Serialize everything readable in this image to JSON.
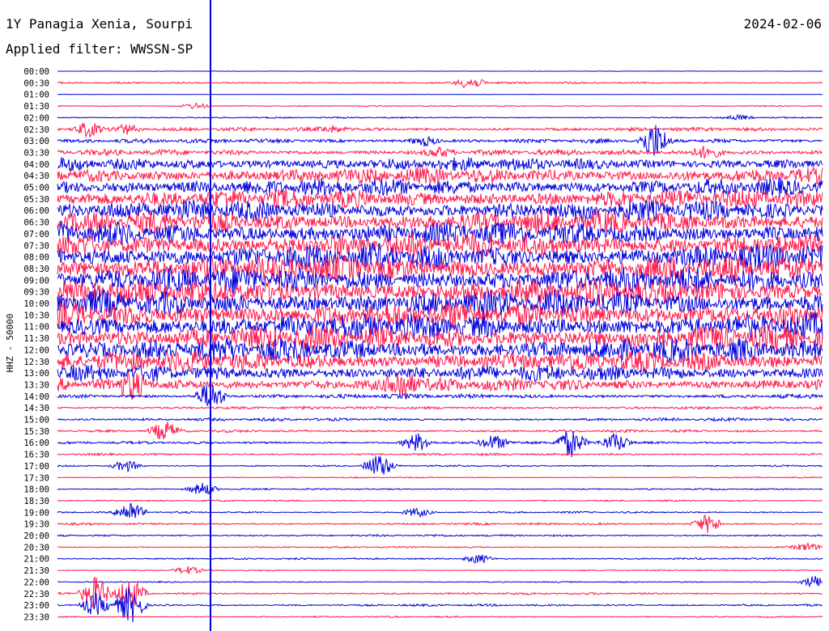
{
  "header": {
    "station": "1Y Panagia Xenia, Sourpi",
    "filter": "Applied filter: WWSSN-SP",
    "date": "2024-02-06"
  },
  "chart_data": {
    "type": "helicorder",
    "title": "1Y Panagia Xenia, Sourpi",
    "date": "2024-02-06",
    "filter": "WWSSN-SP",
    "ylabel": "HHZ - 50000",
    "colors": {
      "even_rows": "#0000dd",
      "odd_rows": "#ff1a4b",
      "time_marker": "#0000dd"
    },
    "rows": [
      {
        "label": "00:00",
        "amplitude": 0.3
      },
      {
        "label": "00:30",
        "amplitude": 1.2
      },
      {
        "label": "01:00",
        "amplitude": 0.3
      },
      {
        "label": "01:30",
        "amplitude": 0.8
      },
      {
        "label": "02:00",
        "amplitude": 1.0
      },
      {
        "label": "02:30",
        "amplitude": 2.5
      },
      {
        "label": "03:00",
        "amplitude": 3.0
      },
      {
        "label": "03:30",
        "amplitude": 4.0
      },
      {
        "label": "04:00",
        "amplitude": 9
      },
      {
        "label": "04:30",
        "amplitude": 11
      },
      {
        "label": "05:00",
        "amplitude": 12
      },
      {
        "label": "05:30",
        "amplitude": 13
      },
      {
        "label": "06:00",
        "amplitude": 14
      },
      {
        "label": "06:30",
        "amplitude": 15
      },
      {
        "label": "07:00",
        "amplitude": 16
      },
      {
        "label": "07:30",
        "amplitude": 17
      },
      {
        "label": "08:00",
        "amplitude": 18
      },
      {
        "label": "08:30",
        "amplitude": 18
      },
      {
        "label": "09:00",
        "amplitude": 18
      },
      {
        "label": "09:30",
        "amplitude": 18
      },
      {
        "label": "10:00",
        "amplitude": 18
      },
      {
        "label": "10:30",
        "amplitude": 18
      },
      {
        "label": "11:00",
        "amplitude": 18
      },
      {
        "label": "11:30",
        "amplitude": 17
      },
      {
        "label": "12:00",
        "amplitude": 16
      },
      {
        "label": "12:30",
        "amplitude": 14
      },
      {
        "label": "13:00",
        "amplitude": 11
      },
      {
        "label": "13:30",
        "amplitude": 9
      },
      {
        "label": "14:00",
        "amplitude": 3
      },
      {
        "label": "14:30",
        "amplitude": 2
      },
      {
        "label": "15:00",
        "amplitude": 2
      },
      {
        "label": "15:30",
        "amplitude": 1.8
      },
      {
        "label": "16:00",
        "amplitude": 1.8
      },
      {
        "label": "16:30",
        "amplitude": 1.5
      },
      {
        "label": "17:00",
        "amplitude": 1.2
      },
      {
        "label": "17:30",
        "amplitude": 0.8
      },
      {
        "label": "18:00",
        "amplitude": 1.0
      },
      {
        "label": "18:30",
        "amplitude": 1.0
      },
      {
        "label": "19:00",
        "amplitude": 1.2
      },
      {
        "label": "19:30",
        "amplitude": 1.4
      },
      {
        "label": "20:00",
        "amplitude": 1.4
      },
      {
        "label": "20:30",
        "amplitude": 1.0
      },
      {
        "label": "21:00",
        "amplitude": 1.2
      },
      {
        "label": "21:30",
        "amplitude": 0.8
      },
      {
        "label": "22:00",
        "amplitude": 0.8
      },
      {
        "label": "22:30",
        "amplitude": 1.5
      },
      {
        "label": "23:00",
        "amplitude": 1.5
      },
      {
        "label": "23:30",
        "amplitude": 1.0
      }
    ],
    "events": [
      {
        "row": "00:30",
        "time_frac": 0.54,
        "amp": 8
      },
      {
        "row": "01:30",
        "time_frac": 0.18,
        "amp": 4
      },
      {
        "row": "02:00",
        "time_frac": 0.89,
        "amp": 3
      },
      {
        "row": "02:30",
        "time_frac": 0.04,
        "amp": 10
      },
      {
        "row": "02:30",
        "time_frac": 0.09,
        "amp": 6
      },
      {
        "row": "02:30",
        "time_frac": 0.36,
        "amp": 4
      },
      {
        "row": "03:00",
        "time_frac": 0.48,
        "amp": 6
      },
      {
        "row": "03:00",
        "time_frac": 0.78,
        "amp": 22
      },
      {
        "row": "03:30",
        "time_frac": 0.5,
        "amp": 5
      },
      {
        "row": "03:30",
        "time_frac": 0.85,
        "amp": 8
      },
      {
        "row": "13:30",
        "time_frac": 0.1,
        "amp": 16
      },
      {
        "row": "13:30",
        "time_frac": 0.45,
        "amp": 20
      },
      {
        "row": "14:00",
        "time_frac": 0.2,
        "amp": 18
      },
      {
        "row": "15:30",
        "time_frac": 0.14,
        "amp": 12
      },
      {
        "row": "16:00",
        "time_frac": 0.47,
        "amp": 12
      },
      {
        "row": "16:00",
        "time_frac": 0.57,
        "amp": 10
      },
      {
        "row": "16:00",
        "time_frac": 0.67,
        "amp": 18
      },
      {
        "row": "16:00",
        "time_frac": 0.73,
        "amp": 12
      },
      {
        "row": "17:00",
        "time_frac": 0.09,
        "amp": 7
      },
      {
        "row": "17:00",
        "time_frac": 0.42,
        "amp": 15
      },
      {
        "row": "18:00",
        "time_frac": 0.19,
        "amp": 8
      },
      {
        "row": "19:00",
        "time_frac": 0.095,
        "amp": 14
      },
      {
        "row": "19:00",
        "time_frac": 0.47,
        "amp": 6
      },
      {
        "row": "19:30",
        "time_frac": 0.85,
        "amp": 12
      },
      {
        "row": "20:30",
        "time_frac": 0.98,
        "amp": 5
      },
      {
        "row": "21:00",
        "time_frac": 0.55,
        "amp": 6
      },
      {
        "row": "21:30",
        "time_frac": 0.17,
        "amp": 5
      },
      {
        "row": "22:00",
        "time_frac": 0.99,
        "amp": 8
      },
      {
        "row": "22:30",
        "time_frac": 0.05,
        "amp": 22
      },
      {
        "row": "22:30",
        "time_frac": 0.095,
        "amp": 20
      },
      {
        "row": "23:00",
        "time_frac": 0.05,
        "amp": 14
      },
      {
        "row": "23:00",
        "time_frac": 0.095,
        "amp": 24
      }
    ],
    "time_marker": {
      "time_frac": 0.2
    }
  }
}
